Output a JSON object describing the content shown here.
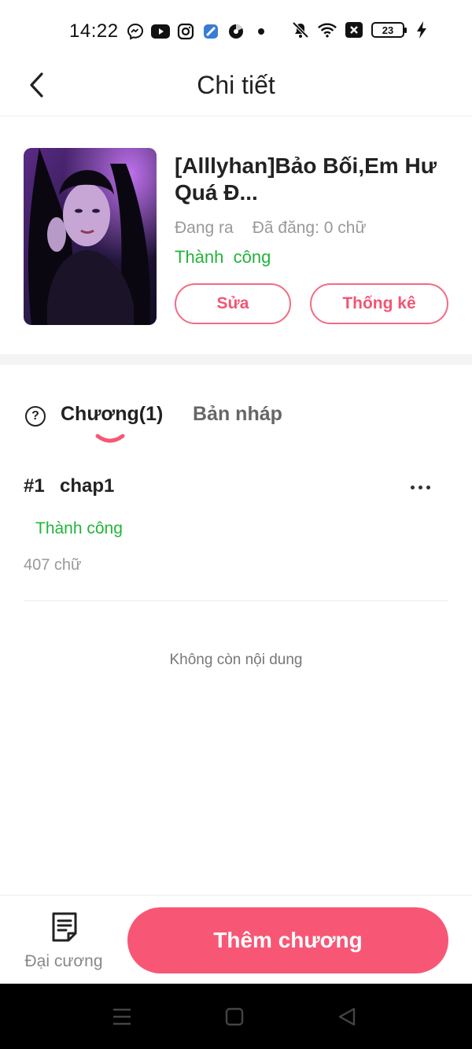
{
  "status_bar": {
    "time": "14:22",
    "battery": "23",
    "icons_left": [
      "messenger-icon",
      "youtube-icon",
      "instagram-icon",
      "app-icon",
      "music-icon",
      "dot-icon"
    ],
    "icons_right": [
      "mute-icon",
      "wifi-icon",
      "close-box-icon",
      "battery-icon",
      "charging-icon"
    ]
  },
  "header": {
    "title": "Chi tiết"
  },
  "book": {
    "title": "[Alllyhan]Bảo Bối,Em Hư Quá Đ...",
    "state": "Đang ra",
    "posted": "Đã đăng: 0 chữ",
    "status": "Thành  công",
    "edit_label": "Sửa",
    "stats_label": "Thống kê"
  },
  "tabs": {
    "chapters": "Chương(1)",
    "drafts": "Bản nháp"
  },
  "chapters": [
    {
      "number": "#1",
      "name": "chap1",
      "status": "Thành công",
      "words": "407 chữ"
    }
  ],
  "end_text": "Không còn nội dung",
  "bottom": {
    "outline_label": "Đại cương",
    "add_chapter_label": "Thêm chương"
  },
  "colors": {
    "accent": "#f75775",
    "success": "#22b43a"
  }
}
